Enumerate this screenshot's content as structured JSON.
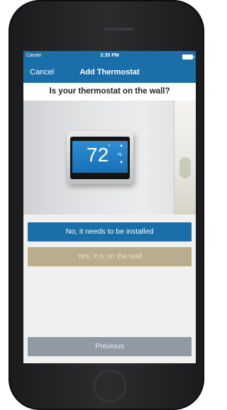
{
  "status_bar": {
    "carrier": "Carrier",
    "time": "3:35 PM"
  },
  "nav": {
    "cancel_label": "Cancel",
    "title": "Add Thermostat"
  },
  "question": "Is your thermostat on the wall?",
  "thermostat_display": {
    "temperature": "72",
    "degree_symbol": "°",
    "setpoint": "71"
  },
  "buttons": {
    "install_label": "No, it needs to be installed",
    "on_wall_label": "Yes, it is on the wall",
    "previous_label": "Previous"
  },
  "colors": {
    "nav": "#1b6fa8",
    "primary_button": "#1b6fa8",
    "selected_button": "#b7ad8f",
    "previous_button": "#9199a3"
  }
}
